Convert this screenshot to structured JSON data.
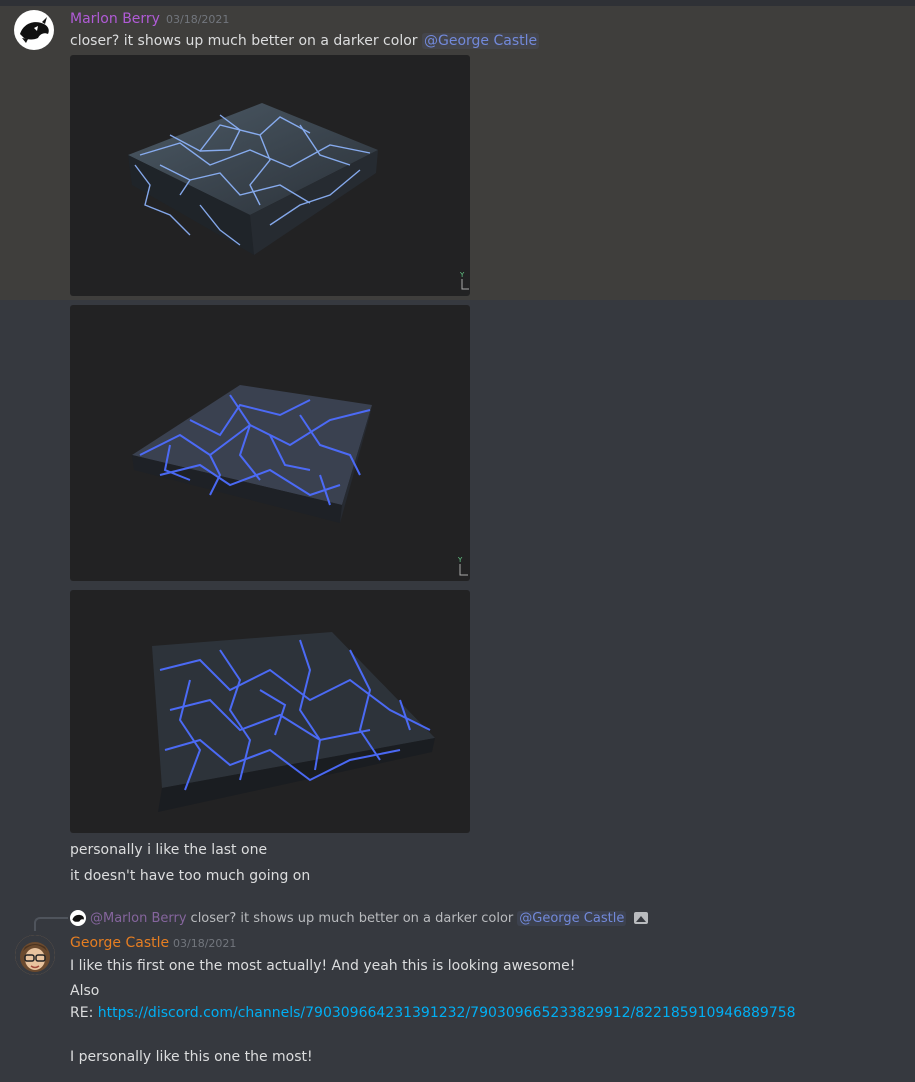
{
  "message1": {
    "author": "Marlon Berry",
    "author_color": "#b05bd6",
    "timestamp": "03/18/2021",
    "text_before_mention": "closer? it shows up much better on a darker color ",
    "mention": "@George Castle"
  },
  "images": [
    {
      "name": "render-1",
      "alt": "cracked glowing tile render 1"
    },
    {
      "name": "render-2",
      "alt": "cracked glowing tile render 2"
    },
    {
      "name": "render-3",
      "alt": "cracked glowing tile render 3"
    }
  ],
  "followups": [
    "personally i like the last one",
    "it doesn't have too much going on"
  ],
  "reply": {
    "author": "@Marlon Berry",
    "text": "closer? it shows up much better on a darker color",
    "mention": "@George Castle"
  },
  "message2": {
    "author": "George Castle",
    "author_color": "#e67e22",
    "timestamp": "03/18/2021",
    "line1": "I like this first one the most actually! And yeah this is looking awesome!",
    "line2": "Also",
    "re_label": "RE: ",
    "link": "https://discord.com/channels/790309664231391232/790309665233829912/822185910946889758",
    "line4": "I personally like this one the most!"
  },
  "colors": {
    "background": "#36393f",
    "highlight": "#3f3e3c",
    "mention": "#7289da",
    "link": "#00aff4",
    "glow": "#5b7bff"
  }
}
